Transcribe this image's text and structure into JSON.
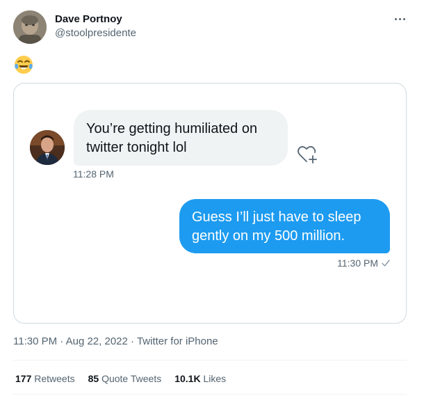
{
  "author": {
    "name": "Dave Portnoy",
    "handle": "@stoolpresidente"
  },
  "tweet": {
    "text": "😂",
    "time": "11:30 PM",
    "date": "Aug 22, 2022",
    "source": "Twitter for iPhone",
    "separator": "·"
  },
  "dm": {
    "received": {
      "text": "You’re getting humiliated on twitter tonight lol",
      "time": "11:28 PM"
    },
    "sent": {
      "text": "Guess I’ll just have to sleep gently on my 500 million.",
      "time": "11:30 PM",
      "status_icon": "check-icon"
    }
  },
  "stats": {
    "retweets": {
      "count": "177",
      "label": "Retweets"
    },
    "quote_tweets": {
      "count": "85",
      "label": "Quote Tweets"
    },
    "likes": {
      "count": "10.1K",
      "label": "Likes"
    }
  },
  "colors": {
    "accent": "#1d9bf0",
    "secondary_text": "#536471",
    "primary_text": "#0f1419",
    "received_bubble": "#eff3f4",
    "border": "#cfd9de"
  },
  "icons": {
    "more": "more-horizontal-icon",
    "reaction": "heart-plus-icon",
    "read_status": "check-icon"
  }
}
